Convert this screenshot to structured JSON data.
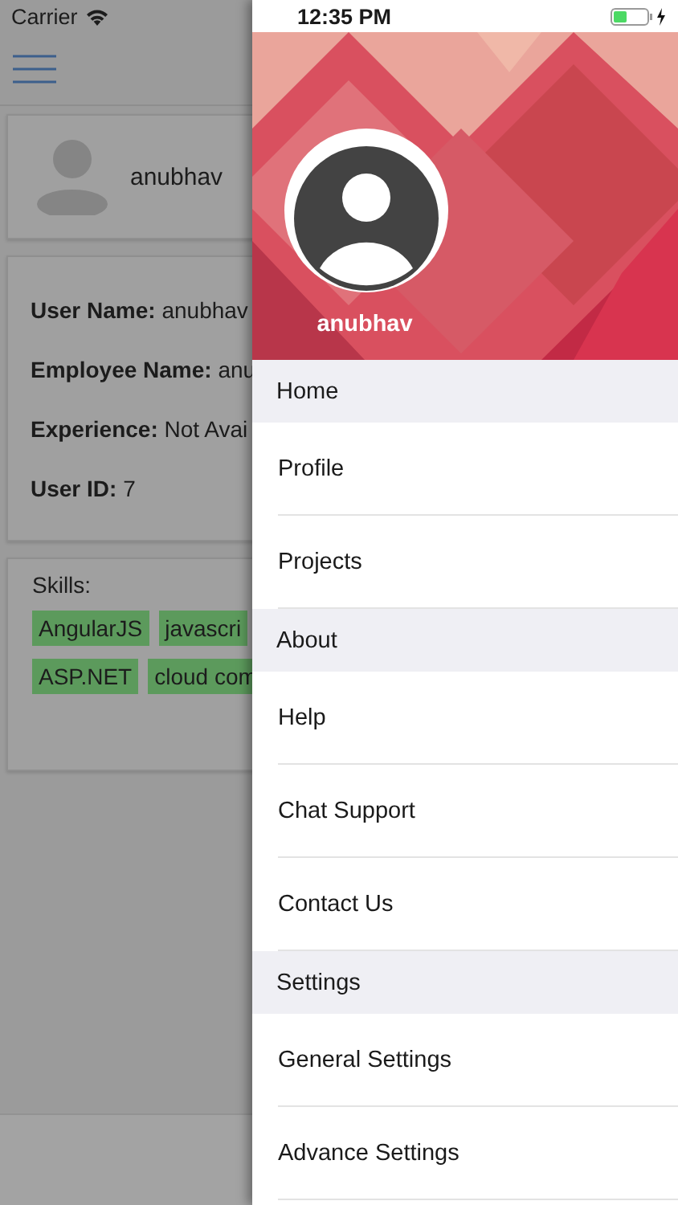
{
  "status_bar": {
    "carrier": "Carrier",
    "time": "12:35 PM"
  },
  "background": {
    "profile_name": "anubhav",
    "details": [
      {
        "label": "User Name:",
        "value": "anubhav"
      },
      {
        "label": "Employee Name:",
        "value": "anu"
      },
      {
        "label": "Experience:",
        "value": "Not Avai"
      },
      {
        "label": "User ID:",
        "value": "7"
      }
    ],
    "skills_title": "Skills:",
    "skills": [
      [
        "AngularJS",
        "javascri"
      ],
      [
        "ASP.NET",
        "cloud com"
      ]
    ]
  },
  "drawer": {
    "user_name": "anubhav",
    "menu": [
      {
        "kind": "section",
        "label": "Home"
      },
      {
        "kind": "item",
        "label": "Profile"
      },
      {
        "kind": "item",
        "label": "Projects"
      },
      {
        "kind": "section",
        "label": "About"
      },
      {
        "kind": "item",
        "label": "Help"
      },
      {
        "kind": "item",
        "label": "Chat Support"
      },
      {
        "kind": "item",
        "label": "Contact Us"
      },
      {
        "kind": "section",
        "label": "Settings"
      },
      {
        "kind": "item",
        "label": "General Settings"
      },
      {
        "kind": "item",
        "label": "Advance Settings"
      }
    ]
  }
}
